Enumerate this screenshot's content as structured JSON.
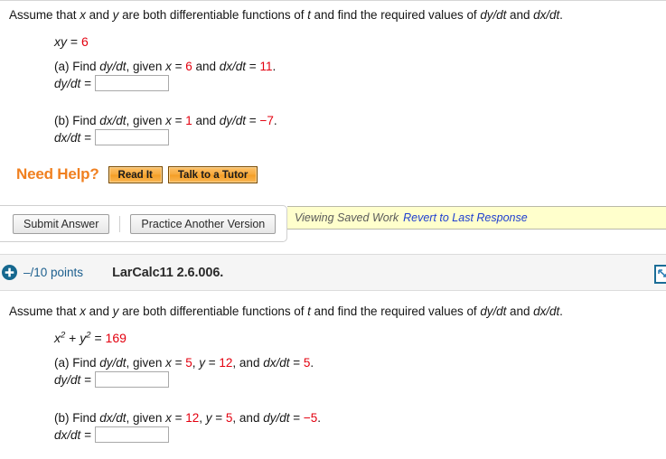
{
  "top_rule": true,
  "problem1": {
    "prompt": {
      "before": "Assume that ",
      "x": "x",
      "mid1": " and ",
      "y": "y",
      "mid2": " are both differentiable functions of ",
      "t": "t",
      "mid3": " and find the required values of ",
      "dydt": "dy/dt",
      "mid4": " and ",
      "dxdt": "dx/dt",
      "end": "."
    },
    "prompt_full": "Assume that x and y are both differentiable functions of t and find the required values of dy/dt and dx/dt.",
    "equation": {
      "lhs": "xy",
      "equals": "=",
      "rhs": "6"
    },
    "parts": [
      {
        "label": "(a) Find ",
        "find": "dy/dt",
        "given_text": ", given ",
        "givens": [
          {
            "var": "x",
            "eq": " = ",
            "value": "6"
          },
          {
            "var": "dx/dt",
            "eq": " = ",
            "value": "11"
          }
        ],
        "conjunction": " and ",
        "period": ".",
        "answer_label": "dy/dt =",
        "answer_value": "",
        "answer_placeholder": ""
      },
      {
        "label": "(b) Find ",
        "find": "dx/dt",
        "given_text": ", given ",
        "givens": [
          {
            "var": "x",
            "eq": " = ",
            "value": "1"
          },
          {
            "var": "dy/dt",
            "eq": " = ",
            "value": "−7"
          }
        ],
        "conjunction": " and ",
        "period": ".",
        "answer_label": "dx/dt =",
        "answer_value": "",
        "answer_placeholder": ""
      }
    ],
    "need_help": {
      "label": "Need Help?",
      "buttons": [
        {
          "name": "read-it",
          "label": "Read It"
        },
        {
          "name": "talk-to-a-tutor",
          "label": "Talk to a Tutor"
        }
      ]
    },
    "actions": {
      "submit_label": "Submit Answer",
      "practice_label": "Practice Another Version"
    },
    "notice": {
      "status": "Viewing Saved Work",
      "link": "Revert to Last Response"
    }
  },
  "section_header": {
    "expand_icon": "plus-circle-icon",
    "points": "–/10 points",
    "assignment_id": "LarCalc11 2.6.006.",
    "notes_icon": "notes-document-icon"
  },
  "problem2": {
    "prompt_full": "Assume that x and y are both differentiable functions of t and find the required values of dy/dt and dx/dt.",
    "prompt": {
      "before": "Assume that ",
      "x": "x",
      "mid1": " and ",
      "y": "y",
      "mid2": " are both differentiable functions of ",
      "t": "t",
      "mid3": " and find the required values of ",
      "dydt": "dy/dt",
      "mid4": " and ",
      "dxdt": "dx/dt",
      "end": "."
    },
    "equation": {
      "term1_base": "x",
      "term1_exp": "2",
      "plus": " + ",
      "term2_base": "y",
      "term2_exp": "2",
      "equals": " = ",
      "rhs": "169"
    },
    "parts": [
      {
        "label": "(a) Find ",
        "find": "dy/dt",
        "given_text": ", given ",
        "givens": [
          {
            "var": "x",
            "eq": " = ",
            "value": "5"
          },
          {
            "var": "y",
            "eq": " = ",
            "value": "12"
          },
          {
            "var": "dx/dt",
            "eq": " = ",
            "value": "5"
          }
        ],
        "conjunction": ", and ",
        "period": ".",
        "answer_label": "dy/dt =",
        "answer_value": "",
        "answer_placeholder": ""
      },
      {
        "label": "(b) Find ",
        "find": "dx/dt",
        "given_text": ", given ",
        "givens": [
          {
            "var": "x",
            "eq": " = ",
            "value": "12"
          },
          {
            "var": "y",
            "eq": " = ",
            "value": "5"
          },
          {
            "var": "dy/dt",
            "eq": " = ",
            "value": "−5"
          }
        ],
        "conjunction": ", and ",
        "period": ".",
        "answer_label": "dx/dt =",
        "answer_value": "",
        "answer_placeholder": ""
      }
    ]
  },
  "colors": {
    "value_red": "#e3000f",
    "need_help_orange": "#f08020",
    "link_blue": "#1f3fd0",
    "points_blue": "#1c5f8e",
    "notice_yellow": "#ffffcc",
    "header_gray": "#f5f5f5"
  }
}
